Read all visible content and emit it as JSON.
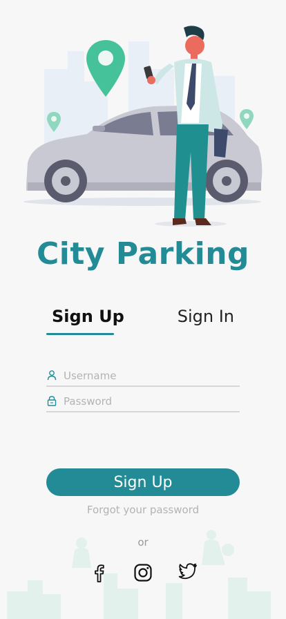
{
  "app": {
    "title": "City Parking"
  },
  "tabs": {
    "signup_label": "Sign Up",
    "signin_label": "Sign In",
    "active": "signup"
  },
  "form": {
    "username_placeholder": "Username",
    "username_value": "",
    "password_placeholder": "Password",
    "password_value": ""
  },
  "actions": {
    "submit_label": "Sign Up",
    "forgot_label": "Forgot your password"
  },
  "social": {
    "separator": "or",
    "icons": [
      "facebook-icon",
      "instagram-icon",
      "twitter-icon"
    ]
  },
  "colors": {
    "accent": "#228b96",
    "background": "#f7f7f7",
    "placeholder": "#b3b3b3",
    "divider": "#d7d7d7"
  }
}
